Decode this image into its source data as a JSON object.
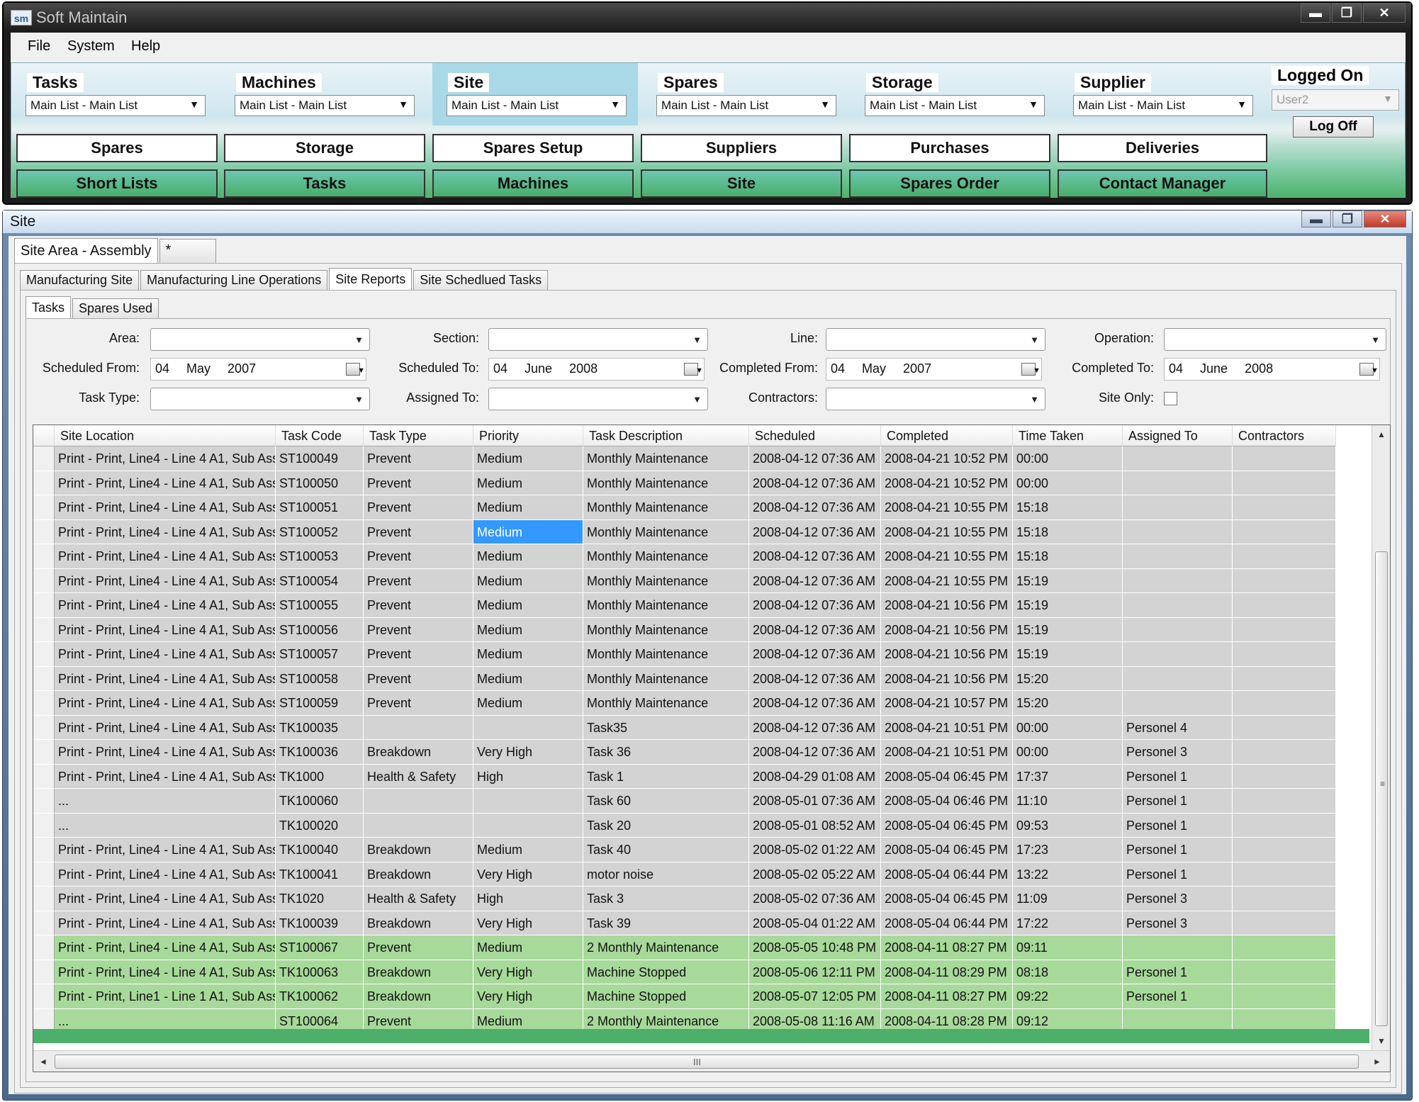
{
  "main_window": {
    "app_icon": "sm",
    "title": "Soft Maintain",
    "window_buttons": {
      "min": "▬",
      "max": "❐",
      "close": "✕"
    },
    "menu": [
      "File",
      "System",
      "Help"
    ],
    "nav_groups": [
      {
        "label": "Tasks",
        "value": "Main List - Main List"
      },
      {
        "label": "Machines",
        "value": "Main List - Main List"
      },
      {
        "label": "Site",
        "value": "Main List - Main List"
      },
      {
        "label": "Spares",
        "value": "Main List - Main List"
      },
      {
        "label": "Storage",
        "value": "Main List  - Main List"
      },
      {
        "label": "Supplier",
        "value": "Main List - Main List"
      }
    ],
    "row1_buttons": [
      "Spares",
      "Storage",
      "Spares Setup",
      "Suppliers",
      "Purchases",
      "Deliveries"
    ],
    "row2_buttons": [
      "Short Lists",
      "Tasks",
      "Machines",
      "Site",
      "Spares Order",
      "Contact Manager"
    ],
    "logged_on": {
      "label": "Logged On",
      "user": "User2",
      "log_off": "Log Off"
    }
  },
  "site_window": {
    "title": "Site",
    "window_buttons": {
      "min": "▬",
      "max": "❐",
      "close": "✕"
    },
    "top_tabs": [
      "Site Area - Assembly",
      "*"
    ],
    "second_tabs": [
      "Manufacturing Site",
      "Manufacturing Line Operations",
      "Site Reports",
      "Site Schedlued Tasks"
    ],
    "third_tabs": [
      "Tasks",
      "Spares Used"
    ],
    "filters": {
      "area": "Area:",
      "section": "Section:",
      "line": "Line:",
      "operation": "Operation:",
      "scheduled_from": "Scheduled From:",
      "scheduled_to": "Scheduled To:",
      "completed_from": "Completed From:",
      "completed_to": "Completed To:",
      "task_type": "Task Type:",
      "assigned_to": "Assigned To:",
      "contractors": "Contractors:",
      "site_only": "Site Only:",
      "sf_date": {
        "d": "04",
        "m": "May",
        "y": "2007"
      },
      "st_date": {
        "d": "04",
        "m": "June",
        "y": "2008"
      },
      "cf_date": {
        "d": "04",
        "m": "May",
        "y": "2007"
      },
      "ct_date": {
        "d": "04",
        "m": "June",
        "y": "2008"
      }
    },
    "grid": {
      "columns": [
        "Site Location",
        "Task Code",
        "Task Type",
        "Priority",
        "Task Description",
        "Scheduled",
        "Completed",
        "Time Taken",
        "Assigned To",
        "Contractors"
      ],
      "rows": [
        [
          "Print - Print, Line4 - Line 4 A1, Sub Ass...",
          "ST100049",
          "Prevent",
          "Medium",
          "Monthly Maintenance",
          "2008-04-12 07:36 AM",
          "2008-04-21 10:52 PM",
          "00:00",
          "",
          ""
        ],
        [
          "Print - Print, Line4 - Line 4 A1, Sub Ass...",
          "ST100050",
          "Prevent",
          "Medium",
          "Monthly Maintenance",
          "2008-04-12 07:36 AM",
          "2008-04-21 10:52 PM",
          "00:00",
          "",
          ""
        ],
        [
          "Print - Print, Line4 - Line 4 A1, Sub Ass...",
          "ST100051",
          "Prevent",
          "Medium",
          "Monthly Maintenance",
          "2008-04-12 07:36 AM",
          "2008-04-21 10:55 PM",
          "15:18",
          "",
          ""
        ],
        [
          "Print - Print, Line4 - Line 4 A1, Sub Ass...",
          "ST100052",
          "Prevent",
          "Medium",
          "Monthly Maintenance",
          "2008-04-12 07:36 AM",
          "2008-04-21 10:55 PM",
          "15:18",
          "",
          ""
        ],
        [
          "Print - Print, Line4 - Line 4 A1, Sub Ass...",
          "ST100053",
          "Prevent",
          "Medium",
          "Monthly Maintenance",
          "2008-04-12 07:36 AM",
          "2008-04-21 10:55 PM",
          "15:18",
          "",
          ""
        ],
        [
          "Print - Print, Line4 - Line 4 A1, Sub Ass...",
          "ST100054",
          "Prevent",
          "Medium",
          "Monthly Maintenance",
          "2008-04-12 07:36 AM",
          "2008-04-21 10:55 PM",
          "15:19",
          "",
          ""
        ],
        [
          "Print - Print, Line4 - Line 4 A1, Sub Ass...",
          "ST100055",
          "Prevent",
          "Medium",
          "Monthly Maintenance",
          "2008-04-12 07:36 AM",
          "2008-04-21 10:56 PM",
          "15:19",
          "",
          ""
        ],
        [
          "Print - Print, Line4 - Line 4 A1, Sub Ass...",
          "ST100056",
          "Prevent",
          "Medium",
          "Monthly Maintenance",
          "2008-04-12 07:36 AM",
          "2008-04-21 10:56 PM",
          "15:19",
          "",
          ""
        ],
        [
          "Print - Print, Line4 - Line 4 A1, Sub Ass...",
          "ST100057",
          "Prevent",
          "Medium",
          "Monthly Maintenance",
          "2008-04-12 07:36 AM",
          "2008-04-21 10:56 PM",
          "15:19",
          "",
          ""
        ],
        [
          "Print - Print, Line4 - Line 4 A1, Sub Ass...",
          "ST100058",
          "Prevent",
          "Medium",
          "Monthly Maintenance",
          "2008-04-12 07:36 AM",
          "2008-04-21 10:56 PM",
          "15:20",
          "",
          ""
        ],
        [
          "Print - Print, Line4 - Line 4 A1, Sub Ass...",
          "ST100059",
          "Prevent",
          "Medium",
          "Monthly Maintenance",
          "2008-04-12 07:36 AM",
          "2008-04-21 10:57 PM",
          "15:20",
          "",
          ""
        ],
        [
          "Print - Print, Line4 - Line 4 A1, Sub Ass...",
          "TK100035",
          "",
          "",
          "Task35",
          "2008-04-12 07:36 AM",
          "2008-04-21 10:51 PM",
          "00:00",
          "Personel 4",
          ""
        ],
        [
          "Print - Print, Line4 - Line 4 A1, Sub Ass...",
          "TK100036",
          "Breakdown",
          "Very High",
          "Task 36",
          "2008-04-12 07:36 AM",
          "2008-04-21 10:51 PM",
          "00:00",
          "Personel 3",
          ""
        ],
        [
          "Print - Print, Line4 - Line 4 A1, Sub Ass...",
          "TK1000",
          "Health & Safety",
          "High",
          "Task 1",
          "2008-04-29 01:08 AM",
          "2008-05-04 06:45 PM",
          "17:37",
          "Personel 1",
          ""
        ],
        [
          "...",
          "TK100060",
          "",
          "",
          "Task 60",
          "2008-05-01 07:36 AM",
          "2008-05-04 06:46 PM",
          "11:10",
          "Personel 1",
          ""
        ],
        [
          "...",
          "TK100020",
          "",
          "",
          "Task 20",
          "2008-05-01 08:52 AM",
          "2008-05-04 06:45 PM",
          "09:53",
          "Personel 1",
          ""
        ],
        [
          "Print - Print, Line4 - Line 4 A1, Sub Ass...",
          "TK100040",
          "Breakdown",
          "Medium",
          "Task 40",
          "2008-05-02 01:22 AM",
          "2008-05-04 06:45 PM",
          "17:23",
          "Personel 1",
          ""
        ],
        [
          "Print - Print, Line4 - Line 4 A1, Sub Ass...",
          "TK100041",
          "Breakdown",
          "Very High",
          "motor noise",
          "2008-05-02 05:22 AM",
          "2008-05-04 06:44 PM",
          "13:22",
          "Personel 1",
          ""
        ],
        [
          "Print - Print, Line4 - Line 4 A1, Sub Ass...",
          "TK1020",
          "Health & Safety",
          "High",
          "Task 3",
          "2008-05-02 07:36 AM",
          "2008-05-04 06:45 PM",
          "11:09",
          "Personel 3",
          ""
        ],
        [
          "Print - Print, Line4 - Line 4 A1, Sub Ass...",
          "TK100039",
          "Breakdown",
          "Very High",
          "Task 39",
          "2008-05-04 01:22 AM",
          "2008-05-04 06:44 PM",
          "17:22",
          "Personel 3",
          ""
        ],
        [
          "Print - Print, Line4 - Line 4 A1, Sub Ass...",
          "ST100067",
          "Prevent",
          "Medium",
          "2 Monthly Maintenance",
          "2008-05-05 10:48 PM",
          "2008-04-11 08:27 PM",
          "09:11",
          "",
          ""
        ],
        [
          "Print - Print, Line4 - Line 4 A1, Sub Ass...",
          "TK100063",
          "Breakdown",
          "Very High",
          "Machine Stopped",
          "2008-05-06 12:11 PM",
          "2008-04-11 08:29 PM",
          "08:18",
          "Personel 1",
          ""
        ],
        [
          "Print - Print, Line1 - Line 1 A1, Sub Ass...",
          "TK100062",
          "Breakdown",
          "Very High",
          "Machine Stopped",
          "2008-05-07 12:05 PM",
          "2008-04-11 08:27 PM",
          "09:22",
          "Personel 1",
          ""
        ],
        [
          "...",
          "ST100064",
          "Prevent",
          "Medium",
          "2 Monthly Maintenance",
          "2008-05-08 11:16 AM",
          "2008-04-11 08:28 PM",
          "09:12",
          "",
          ""
        ]
      ],
      "green_from_row": 20,
      "selected_cell": {
        "row": 3,
        "col": 3
      },
      "scroll_arrows": {
        "up": "▲",
        "down": "▼",
        "left": "◄",
        "right": "►"
      },
      "grips": {
        "v": "≡",
        "h": "III"
      }
    }
  }
}
